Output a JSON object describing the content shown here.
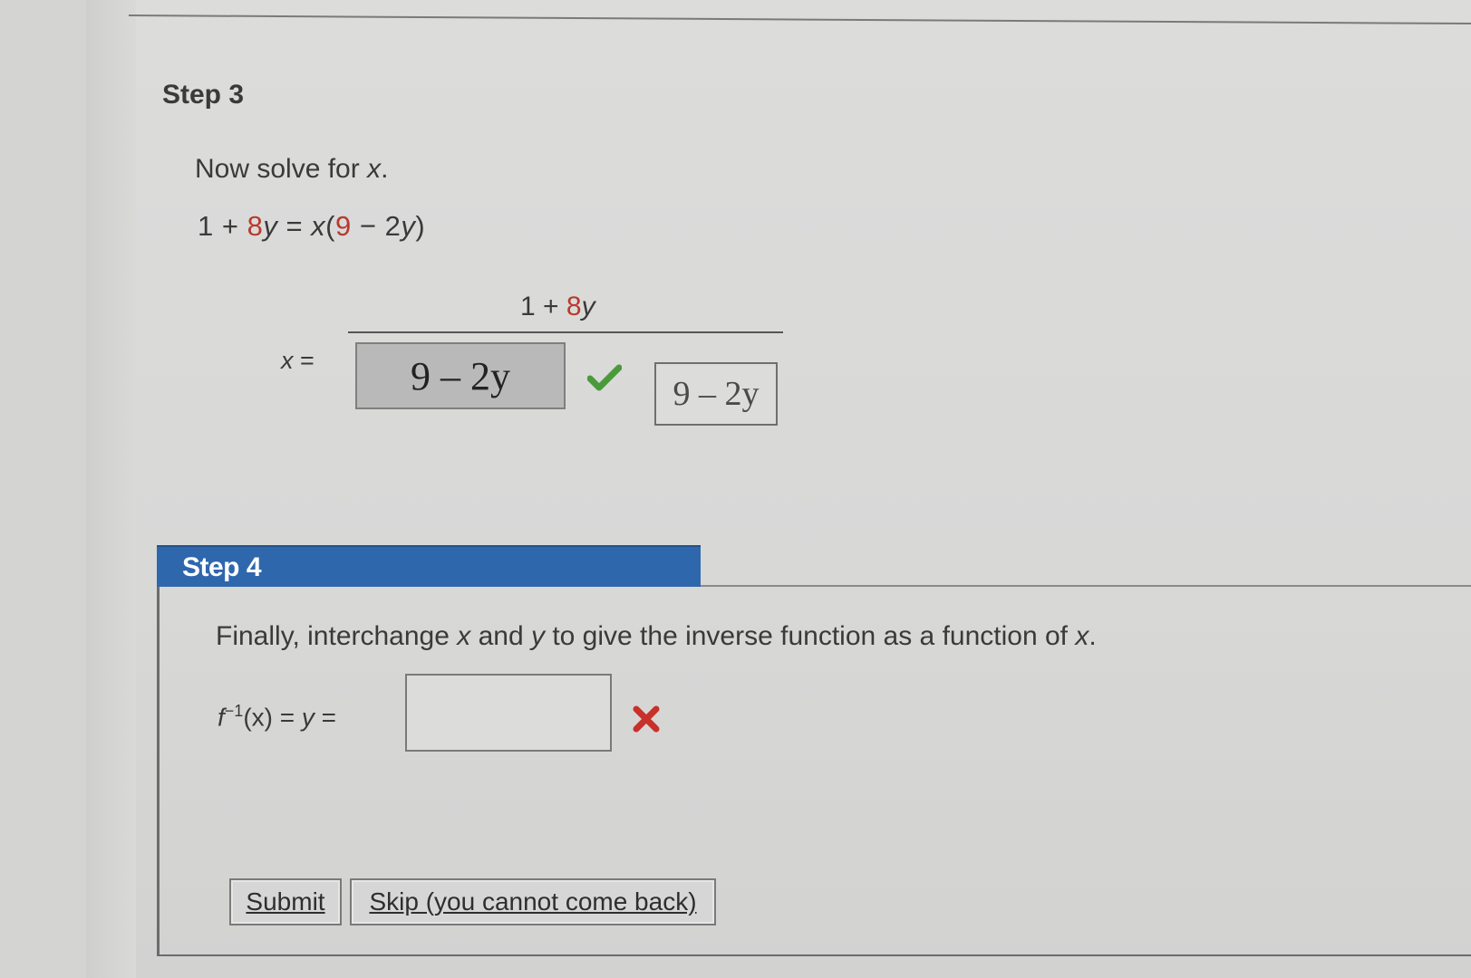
{
  "step3": {
    "title": "Step 3",
    "prompt_pre": "Now solve for ",
    "prompt_var": "x",
    "prompt_post": ".",
    "equation": {
      "lhs_one": "1 + ",
      "lhs_red": "8",
      "lhs_var": "y",
      "equals": " = ",
      "rhs_var": "x",
      "rhs_open": "(",
      "rhs_red": "9",
      "rhs_rest_pre": " − 2",
      "rhs_rest_var": "y",
      "rhs_close": ")"
    },
    "x_equals_var": "x",
    "x_equals_sign": " =",
    "numerator_pre": "1 + ",
    "numerator_red": "8",
    "numerator_var": "y",
    "answer_value": "9 – 2y",
    "preview_value": "9 – 2y"
  },
  "step4": {
    "title": "Step 4",
    "prompt": {
      "p1": "Finally, interchange ",
      "v1": "x",
      "p2": " and ",
      "v2": "y",
      "p3": " to give the inverse function as a function of ",
      "v3": "x",
      "p4": "."
    },
    "finv": {
      "f": "f",
      "exp": "−1",
      "arg": "(x)",
      "eq1": " = ",
      "y": "y",
      "eq2": " ="
    },
    "answer_value": ""
  },
  "buttons": {
    "submit_label": "Submit",
    "skip_label": "Skip (you cannot come back)"
  },
  "colors": {
    "header_blue": "#2f67ad",
    "check_green": "#4a9a3c",
    "error_red": "#c8302a",
    "accent_red": "#b83a2e"
  }
}
